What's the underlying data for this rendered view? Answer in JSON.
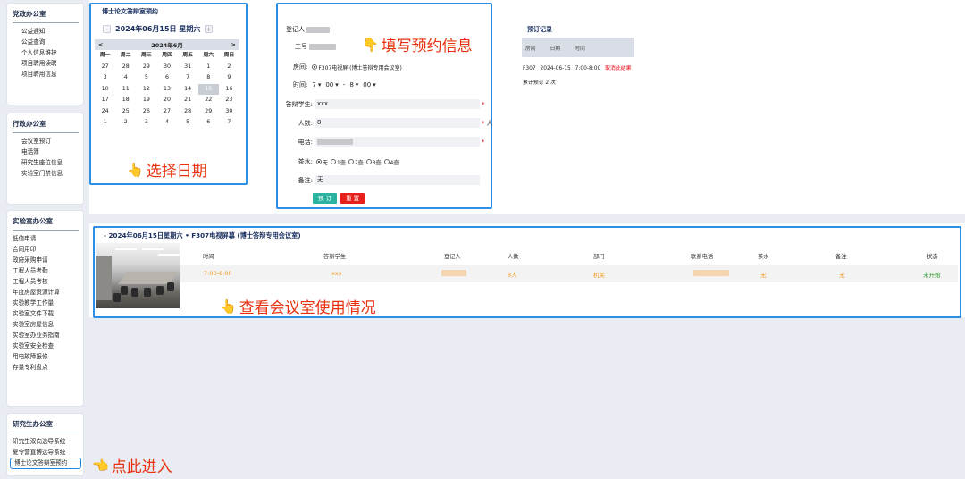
{
  "sidebar": {
    "groups": [
      {
        "title": "党政办公室",
        "items": [
          "公益通知",
          "公益查询",
          "个人信息维护",
          "项目聘用读聘",
          "项目聘用信息"
        ]
      },
      {
        "title": "行政办公室",
        "items": [
          "会议室预订",
          "电话簿",
          "研究生座位信息",
          "实验室门禁信息"
        ]
      },
      {
        "title": "实验室办公室",
        "items": [
          "低值申请",
          "合同用印",
          "政府采购申请",
          "工程人员考勤",
          "工程人员考核",
          "年度房屋资源计算",
          "实验教学工作量",
          "实验室文件下载",
          "实验室房屋信息",
          "实验室办业务指南",
          "实验室安全检查",
          "用电故障报修",
          "存量专利盘点"
        ]
      },
      {
        "title": "研究生办公室",
        "items": [
          "研究生双向选导系统",
          "夏令营直博选导系统",
          "博士论文答辩室预约"
        ]
      }
    ]
  },
  "annotations": {
    "fill": "填写预约信息",
    "pick_date": "选择日期",
    "check_usage": "查看会议室使用情况",
    "enter": "点此进入"
  },
  "calendar": {
    "title": "博士论文答辩室预约",
    "prev": "-",
    "next": "+",
    "date_label": "2024年06月15日 星期六",
    "month_prev": "<",
    "month_next": ">",
    "month_label": "2024年6月",
    "weekdays": [
      "周一",
      "周二",
      "周三",
      "周四",
      "周五",
      "周六",
      "周日"
    ],
    "days": [
      "27",
      "28",
      "29",
      "30",
      "31",
      "1",
      "2",
      "3",
      "4",
      "5",
      "6",
      "7",
      "8",
      "9",
      "10",
      "11",
      "12",
      "13",
      "14",
      "15",
      "16",
      "17",
      "18",
      "19",
      "20",
      "21",
      "22",
      "23",
      "24",
      "25",
      "26",
      "27",
      "28",
      "29",
      "30",
      "1",
      "2",
      "3",
      "4",
      "5",
      "6",
      "7"
    ],
    "selected": "15"
  },
  "form": {
    "registrant_label": "登记人",
    "workno_label": "工号",
    "room_label": "房间:",
    "room_value": "F307电视屏 (博士答辩专用会议室)",
    "time_label": "时间:",
    "start_hour": "7",
    "start_min": "00",
    "dash": "-",
    "end_hour": "8",
    "end_min": "00",
    "student_label": "答辩学生:",
    "student_value": "xxx",
    "people_label": "人数:",
    "people_value": "8",
    "people_unit": "人",
    "phone_label": "电话:",
    "tea_label": "茶水:",
    "tea_options": [
      "无",
      "1壶",
      "2壶",
      "3壶",
      "4壶"
    ],
    "note_label": "备注:",
    "note_value": "无",
    "req": "*",
    "submit": "预 订",
    "reset": "重 置"
  },
  "records": {
    "title": "预订记录",
    "headers": [
      "房间",
      "日期",
      "时间"
    ],
    "row": {
      "room": "F307",
      "date": "2024-06-15",
      "time": "7:00-8:00",
      "action": "取消此结果"
    },
    "count": "累计预订 2 次"
  },
  "usage": {
    "title": "2024年06月15日星期六 • F307电视屏幕 (博士答辩专用会议室)",
    "prefix": "-",
    "headers": [
      "时间",
      "答辩学生",
      "登记人",
      "人数",
      "部门",
      "联系电话",
      "茶水",
      "备注",
      "状态"
    ],
    "row": {
      "time": "7:00-8:00",
      "student": "xxx",
      "people": "8人",
      "dept": "机关",
      "tea": "无",
      "note": "无",
      "status": "未开始"
    }
  },
  "colors": {
    "accent": "#2d8ee6",
    "annotation": "#e8320f",
    "submit": "#2bb3a0",
    "reset": "#e8201c",
    "status_green": "#2f9430",
    "value_orange": "#f29b1e"
  }
}
